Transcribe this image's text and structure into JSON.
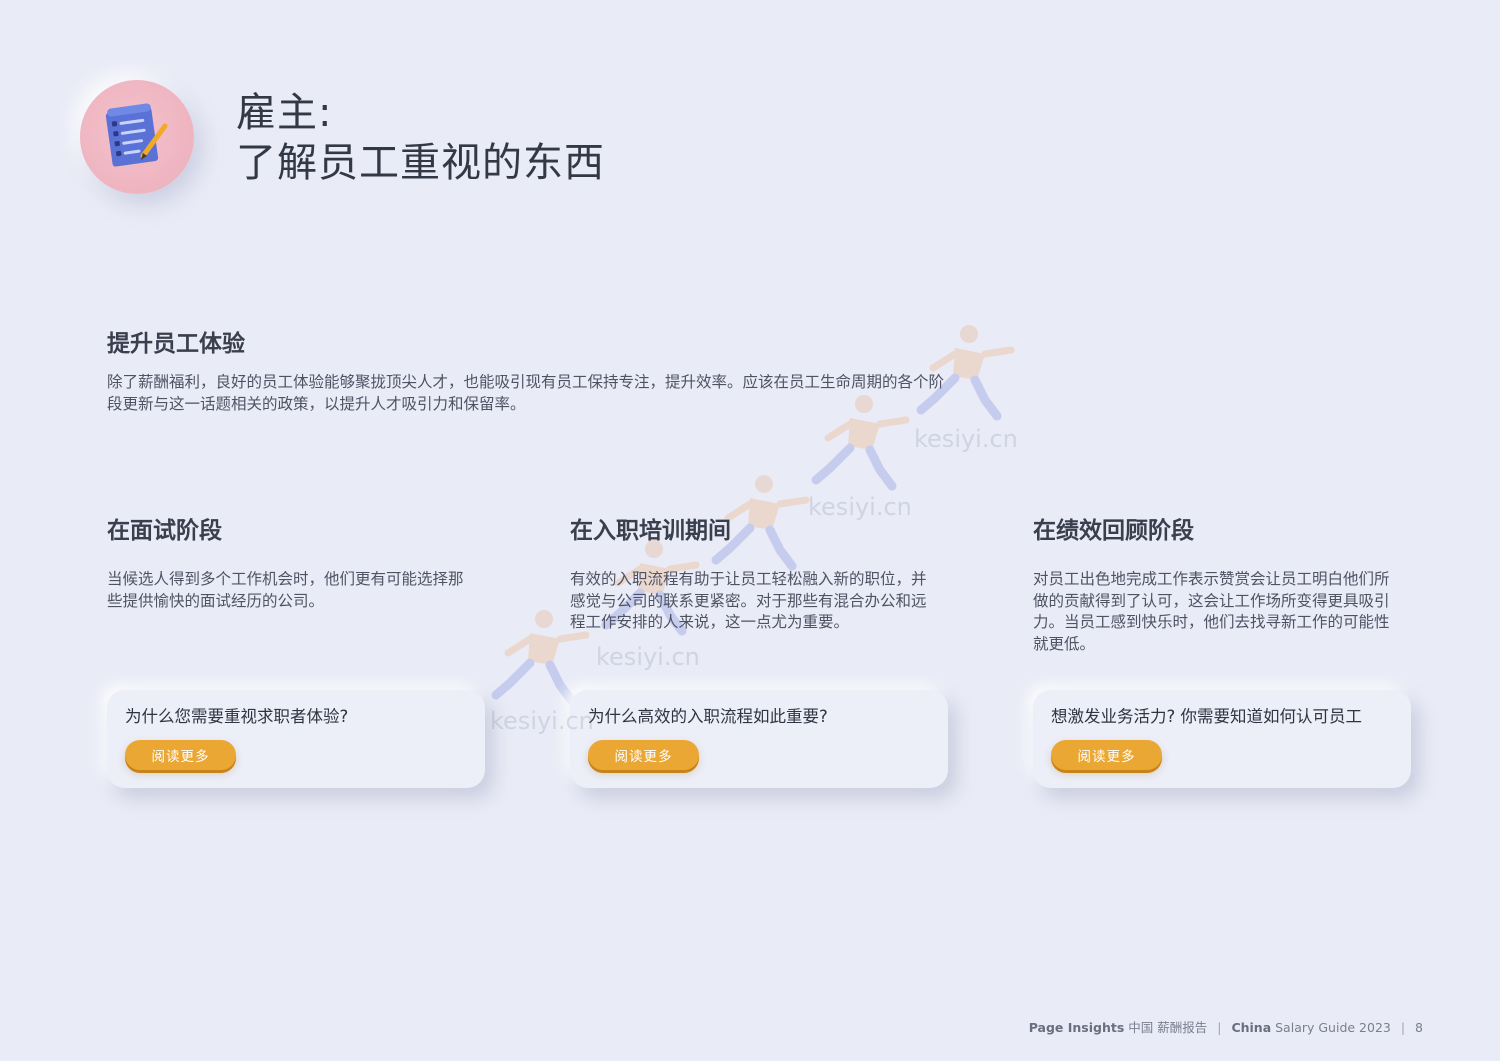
{
  "header": {
    "title_line1": "雇主:",
    "title_line2": "了解员工重视的东西",
    "badge_icon": "document-checklist-icon"
  },
  "intro": {
    "heading": "提升员工体验",
    "text": "除了薪酬福利，良好的员工体验能够聚拢顶尖人才，也能吸引现有员工保持专注，提升效率。应该在员工生命周期的各个阶段更新与这一话题相关的政策，以提升人才吸引力和保留率。"
  },
  "columns": [
    {
      "heading": "在面试阶段",
      "text": "当候选人得到多个工作机会时，他们更有可能选择那些提供愉快的面试经历的公司。",
      "card_title": "为什么您需要重视求职者体验?",
      "button_label": "阅读更多"
    },
    {
      "heading": "在入职培训期间",
      "text": "有效的入职流程有助于让员工轻松融入新的职位，并感觉与公司的联系更紧密。对于那些有混合办公和远程工作安排的人来说，这一点尤为重要。",
      "card_title": "为什么高效的入职流程如此重要?",
      "button_label": "阅读更多"
    },
    {
      "heading": "在绩效回顾阶段",
      "text": "对员工出色地完成工作表示赞赏会让员工明白他们所做的贡献得到了认可，这会让工作场所变得更具吸引力。当员工感到快乐时，他们去找寻新工作的可能性就更低。",
      "card_title": "想激发业务活力? 你需要知道如何认可员工",
      "button_label": "阅读更多"
    }
  ],
  "watermark": {
    "text": "kesiyi.cn",
    "icon": "running-person-icon"
  },
  "footer": {
    "brand_bold": "Page Insights",
    "brand_cn": "中国 薪酬报告",
    "guide_bold": "China",
    "guide_rest": "Salary Guide 2023",
    "page_number": "8"
  },
  "colors": {
    "background": "#e9ebf6",
    "accent_button": "#eaa733",
    "badge": "#f0b8c4",
    "document_icon": "#5a72d6"
  }
}
